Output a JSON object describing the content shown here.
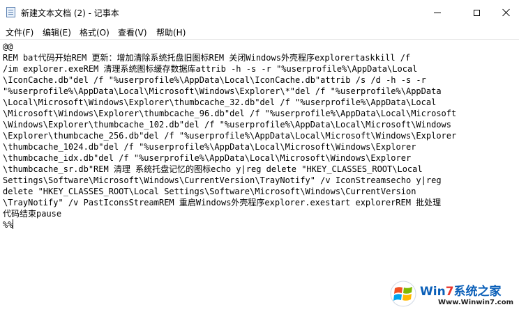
{
  "window": {
    "title": "新建文本文档 (2) - 记事本"
  },
  "menu": {
    "items": [
      {
        "label": "文件(F)"
      },
      {
        "label": "编辑(E)"
      },
      {
        "label": "格式(O)"
      },
      {
        "label": "查看(V)"
      },
      {
        "label": "帮助(H)"
      }
    ]
  },
  "editor": {
    "lines": [
      "@@",
      "REM bat代码开始REM 更新：增加清除系统托盘旧图标REM 关闭Windows外壳程序explorertaskkill /f",
      "/im explorer.exeREM 清理系统图标缓存数据库attrib -h -s -r \"%userprofile%\\AppData\\Local",
      "\\IconCache.db\"del /f \"%userprofile%\\AppData\\Local\\IconCache.db\"attrib /s /d -h -s -r",
      "\"%userprofile%\\AppData\\Local\\Microsoft\\Windows\\Explorer\\*\"del /f \"%userprofile%\\AppData",
      "\\Local\\Microsoft\\Windows\\Explorer\\thumbcache_32.db\"del /f \"%userprofile%\\AppData\\Local",
      "\\Microsoft\\Windows\\Explorer\\thumbcache_96.db\"del /f \"%userprofile%\\AppData\\Local\\Microsoft",
      "\\Windows\\Explorer\\thumbcache_102.db\"del /f \"%userprofile%\\AppData\\Local\\Microsoft\\Windows",
      "\\Explorer\\thumbcache_256.db\"del /f \"%userprofile%\\AppData\\Local\\Microsoft\\Windows\\Explorer",
      "\\thumbcache_1024.db\"del /f \"%userprofile%\\AppData\\Local\\Microsoft\\Windows\\Explorer",
      "\\thumbcache_idx.db\"del /f \"%userprofile%\\AppData\\Local\\Microsoft\\Windows\\Explorer",
      "\\thumbcache_sr.db\"REM 清理 系统托盘记忆的图标echo y|reg delete \"HKEY_CLASSES_ROOT\\Local",
      "Settings\\Software\\Microsoft\\Windows\\CurrentVersion\\TrayNotify\" /v IconStreamsecho y|reg",
      "delete \"HKEY_CLASSES_ROOT\\Local Settings\\Software\\Microsoft\\Windows\\CurrentVersion",
      "\\TrayNotify\" /v PastIconsStreamREM 重启Windows外壳程序explorer.exestart explorerREM 批处理",
      "代码结束pause",
      "%%"
    ]
  },
  "watermark": {
    "brand_prefix": "Win",
    "brand_seven": "7",
    "brand_suffix": "系统之家",
    "url": "Www.Winwin7.com"
  }
}
